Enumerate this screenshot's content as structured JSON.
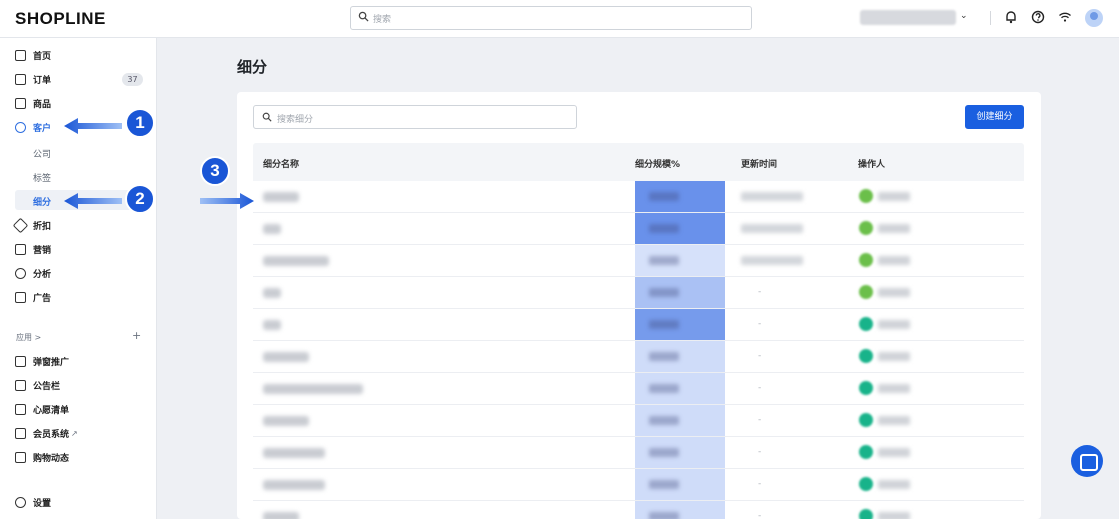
{
  "header": {
    "logo": "SHOPLINE",
    "search_placeholder": "搜索"
  },
  "sidebar": {
    "items": [
      {
        "label": "首页",
        "icon": "home-icon"
      },
      {
        "label": "订单",
        "icon": "order-icon",
        "badge": "37"
      },
      {
        "label": "商品",
        "icon": "product-icon"
      },
      {
        "label": "客户",
        "icon": "customer-icon"
      },
      {
        "label": "折扣",
        "icon": "discount-icon"
      },
      {
        "label": "营销",
        "icon": "marketing-icon"
      },
      {
        "label": "分析",
        "icon": "analytics-icon"
      },
      {
        "label": "广告",
        "icon": "ads-icon"
      }
    ],
    "customer_sub": [
      "公司",
      "标签",
      "细分"
    ],
    "apps_label": "应用 >",
    "apps_plus": "+",
    "apps": [
      {
        "label": "弹窗推广",
        "icon": "popup-icon"
      },
      {
        "label": "公告栏",
        "icon": "announcement-icon"
      },
      {
        "label": "心愿清单",
        "icon": "wishlist-icon"
      },
      {
        "label": "会员系统",
        "icon": "membership-icon",
        "external": "↗"
      },
      {
        "label": "购物动态",
        "icon": "shopping-feed-icon"
      }
    ],
    "settings": {
      "label": "设置",
      "icon": "settings-icon"
    }
  },
  "main": {
    "title": "细分",
    "search_placeholder": "搜索细分",
    "create_button": "创建细分",
    "columns": [
      "细分名称",
      "细分规模%",
      "更新时间",
      "操作人"
    ],
    "rows": [
      {
        "update": "blurred",
        "size_level": 0.95
      },
      {
        "update": "blurred",
        "size_level": 0.95
      },
      {
        "update": "blurred",
        "size_level": 0.1
      },
      {
        "update": "-",
        "size_level": 0.45
      },
      {
        "update": "-",
        "size_level": 0.85
      },
      {
        "update": "-",
        "size_level": 0.15
      },
      {
        "update": "-",
        "size_level": 0.15
      },
      {
        "update": "-",
        "size_level": 0.15
      },
      {
        "update": "-",
        "size_level": 0.15
      },
      {
        "update": "-",
        "size_level": 0.15
      },
      {
        "update": "-",
        "size_level": 0.15
      }
    ]
  },
  "annotations": [
    "1",
    "2",
    "3"
  ],
  "colors": {
    "accent": "#1a5fe0",
    "annotation": "#1a56d6"
  }
}
